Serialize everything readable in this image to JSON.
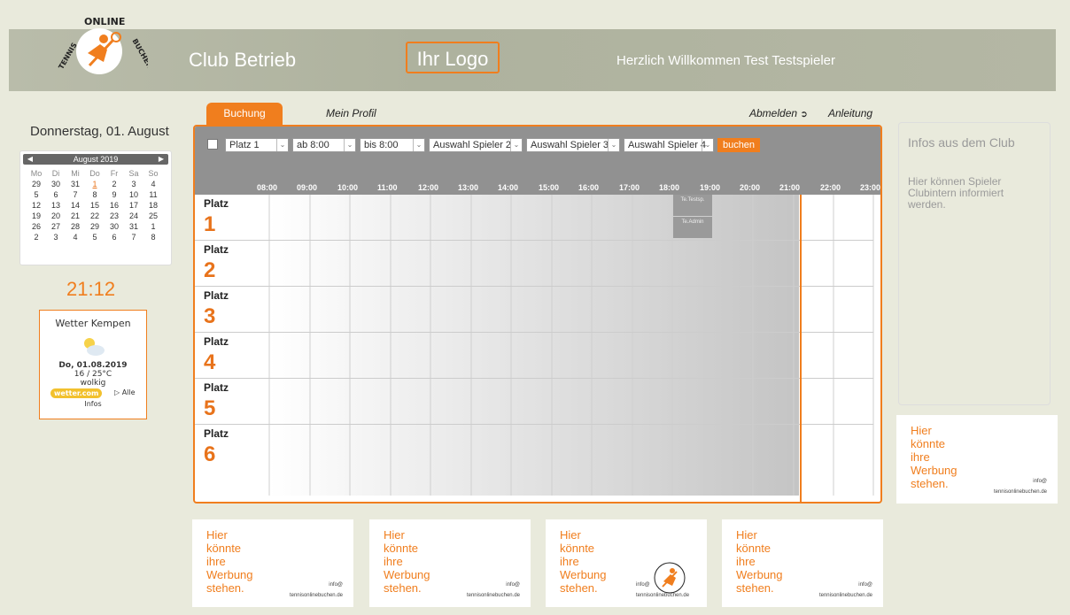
{
  "header": {
    "title": "Club Betrieb",
    "logo_placeholder": "Ihr Logo",
    "welcome": "Herzlich Willkommen Test Testspieler",
    "brand_top": "ONLINE",
    "brand_left": "TENNIS",
    "brand_right": "BUCHEN"
  },
  "sidebar": {
    "date": "Donnerstag, 01. August",
    "calendar": {
      "month": "August 2019",
      "weekdays": [
        "Mo",
        "Di",
        "Mi",
        "Do",
        "Fr",
        "Sa",
        "So"
      ],
      "weeks": [
        [
          "29",
          "30",
          "31",
          "1",
          "2",
          "3",
          "4"
        ],
        [
          "5",
          "6",
          "7",
          "8",
          "9",
          "10",
          "11"
        ],
        [
          "12",
          "13",
          "14",
          "15",
          "16",
          "17",
          "18"
        ],
        [
          "19",
          "20",
          "21",
          "22",
          "23",
          "24",
          "25"
        ],
        [
          "26",
          "27",
          "28",
          "29",
          "30",
          "31",
          "1"
        ],
        [
          "2",
          "3",
          "4",
          "5",
          "6",
          "7",
          "8"
        ]
      ]
    },
    "clock": "21:12",
    "weather": {
      "title": "Wetter Kempen",
      "date": "Do, 01.08.2019",
      "temp": "16 / 25°C",
      "condition": "wolkig",
      "brand": "wetter.com",
      "link": "Alle",
      "link2": "Infos"
    }
  },
  "tabs": {
    "buchung": "Buchung",
    "profil": "Mein Profil",
    "abmelden": "Abmelden",
    "anleitung": "Anleitung"
  },
  "toolbar": {
    "platz": "Platz 1",
    "ab": "ab  8:00",
    "bis": "bis  8:00",
    "spieler2": "Auswahl Spieler 2",
    "spieler3": "Auswahl Spieler 3",
    "spieler4": "Auswahl Spieler 4",
    "buchen": "buchen"
  },
  "hours": [
    "08:00",
    "09:00",
    "10:00",
    "11:00",
    "12:00",
    "13:00",
    "14:00",
    "15:00",
    "16:00",
    "17:00",
    "18:00",
    "19:00",
    "20:00",
    "21:00",
    "22:00",
    "23:00"
  ],
  "courts": [
    {
      "label": "Platz",
      "num": "1"
    },
    {
      "label": "Platz",
      "num": "2"
    },
    {
      "label": "Platz",
      "num": "3"
    },
    {
      "label": "Platz",
      "num": "4"
    },
    {
      "label": "Platz",
      "num": "5"
    },
    {
      "label": "Platz",
      "num": "6"
    }
  ],
  "bookings": {
    "b1": "Te.Testsp.",
    "b2": "Te.Admin"
  },
  "infos": {
    "title": "Infos aus dem Club",
    "text": "Hier können Spieler Clubintern informiert werden."
  },
  "ads": {
    "line1": "Hier",
    "line2": "könnte",
    "line3": "ihre",
    "line4": "Werbung",
    "line5": "stehen.",
    "contact1": "info@",
    "contact2": "tennisonlinebuchen.de"
  },
  "colors": {
    "accent": "#f07e1e",
    "toolbar": "#919191",
    "banner": "#b1b4a0"
  }
}
